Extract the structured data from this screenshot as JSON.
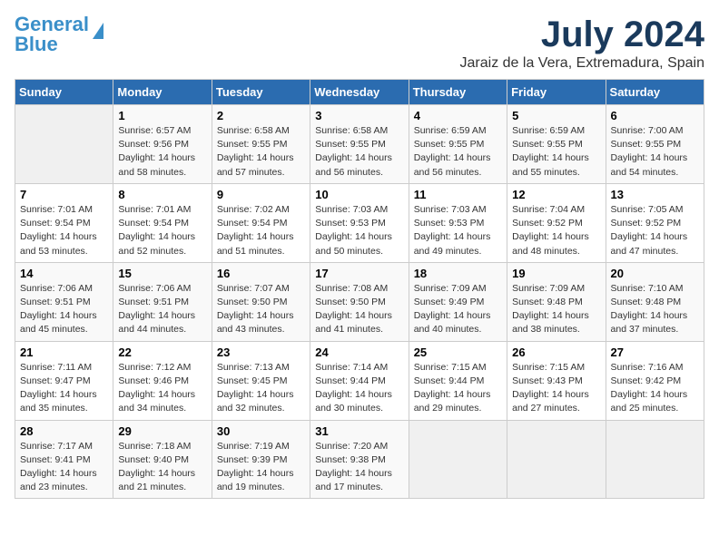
{
  "header": {
    "logo_line1": "General",
    "logo_line2": "Blue",
    "month": "July 2024",
    "location": "Jaraiz de la Vera, Extremadura, Spain"
  },
  "days_of_week": [
    "Sunday",
    "Monday",
    "Tuesday",
    "Wednesday",
    "Thursday",
    "Friday",
    "Saturday"
  ],
  "weeks": [
    [
      {
        "day": "",
        "info": ""
      },
      {
        "day": "1",
        "info": "Sunrise: 6:57 AM\nSunset: 9:56 PM\nDaylight: 14 hours\nand 58 minutes."
      },
      {
        "day": "2",
        "info": "Sunrise: 6:58 AM\nSunset: 9:55 PM\nDaylight: 14 hours\nand 57 minutes."
      },
      {
        "day": "3",
        "info": "Sunrise: 6:58 AM\nSunset: 9:55 PM\nDaylight: 14 hours\nand 56 minutes."
      },
      {
        "day": "4",
        "info": "Sunrise: 6:59 AM\nSunset: 9:55 PM\nDaylight: 14 hours\nand 56 minutes."
      },
      {
        "day": "5",
        "info": "Sunrise: 6:59 AM\nSunset: 9:55 PM\nDaylight: 14 hours\nand 55 minutes."
      },
      {
        "day": "6",
        "info": "Sunrise: 7:00 AM\nSunset: 9:55 PM\nDaylight: 14 hours\nand 54 minutes."
      }
    ],
    [
      {
        "day": "7",
        "info": "Sunrise: 7:01 AM\nSunset: 9:54 PM\nDaylight: 14 hours\nand 53 minutes."
      },
      {
        "day": "8",
        "info": "Sunrise: 7:01 AM\nSunset: 9:54 PM\nDaylight: 14 hours\nand 52 minutes."
      },
      {
        "day": "9",
        "info": "Sunrise: 7:02 AM\nSunset: 9:54 PM\nDaylight: 14 hours\nand 51 minutes."
      },
      {
        "day": "10",
        "info": "Sunrise: 7:03 AM\nSunset: 9:53 PM\nDaylight: 14 hours\nand 50 minutes."
      },
      {
        "day": "11",
        "info": "Sunrise: 7:03 AM\nSunset: 9:53 PM\nDaylight: 14 hours\nand 49 minutes."
      },
      {
        "day": "12",
        "info": "Sunrise: 7:04 AM\nSunset: 9:52 PM\nDaylight: 14 hours\nand 48 minutes."
      },
      {
        "day": "13",
        "info": "Sunrise: 7:05 AM\nSunset: 9:52 PM\nDaylight: 14 hours\nand 47 minutes."
      }
    ],
    [
      {
        "day": "14",
        "info": "Sunrise: 7:06 AM\nSunset: 9:51 PM\nDaylight: 14 hours\nand 45 minutes."
      },
      {
        "day": "15",
        "info": "Sunrise: 7:06 AM\nSunset: 9:51 PM\nDaylight: 14 hours\nand 44 minutes."
      },
      {
        "day": "16",
        "info": "Sunrise: 7:07 AM\nSunset: 9:50 PM\nDaylight: 14 hours\nand 43 minutes."
      },
      {
        "day": "17",
        "info": "Sunrise: 7:08 AM\nSunset: 9:50 PM\nDaylight: 14 hours\nand 41 minutes."
      },
      {
        "day": "18",
        "info": "Sunrise: 7:09 AM\nSunset: 9:49 PM\nDaylight: 14 hours\nand 40 minutes."
      },
      {
        "day": "19",
        "info": "Sunrise: 7:09 AM\nSunset: 9:48 PM\nDaylight: 14 hours\nand 38 minutes."
      },
      {
        "day": "20",
        "info": "Sunrise: 7:10 AM\nSunset: 9:48 PM\nDaylight: 14 hours\nand 37 minutes."
      }
    ],
    [
      {
        "day": "21",
        "info": "Sunrise: 7:11 AM\nSunset: 9:47 PM\nDaylight: 14 hours\nand 35 minutes."
      },
      {
        "day": "22",
        "info": "Sunrise: 7:12 AM\nSunset: 9:46 PM\nDaylight: 14 hours\nand 34 minutes."
      },
      {
        "day": "23",
        "info": "Sunrise: 7:13 AM\nSunset: 9:45 PM\nDaylight: 14 hours\nand 32 minutes."
      },
      {
        "day": "24",
        "info": "Sunrise: 7:14 AM\nSunset: 9:44 PM\nDaylight: 14 hours\nand 30 minutes."
      },
      {
        "day": "25",
        "info": "Sunrise: 7:15 AM\nSunset: 9:44 PM\nDaylight: 14 hours\nand 29 minutes."
      },
      {
        "day": "26",
        "info": "Sunrise: 7:15 AM\nSunset: 9:43 PM\nDaylight: 14 hours\nand 27 minutes."
      },
      {
        "day": "27",
        "info": "Sunrise: 7:16 AM\nSunset: 9:42 PM\nDaylight: 14 hours\nand 25 minutes."
      }
    ],
    [
      {
        "day": "28",
        "info": "Sunrise: 7:17 AM\nSunset: 9:41 PM\nDaylight: 14 hours\nand 23 minutes."
      },
      {
        "day": "29",
        "info": "Sunrise: 7:18 AM\nSunset: 9:40 PM\nDaylight: 14 hours\nand 21 minutes."
      },
      {
        "day": "30",
        "info": "Sunrise: 7:19 AM\nSunset: 9:39 PM\nDaylight: 14 hours\nand 19 minutes."
      },
      {
        "day": "31",
        "info": "Sunrise: 7:20 AM\nSunset: 9:38 PM\nDaylight: 14 hours\nand 17 minutes."
      },
      {
        "day": "",
        "info": ""
      },
      {
        "day": "",
        "info": ""
      },
      {
        "day": "",
        "info": ""
      }
    ]
  ]
}
